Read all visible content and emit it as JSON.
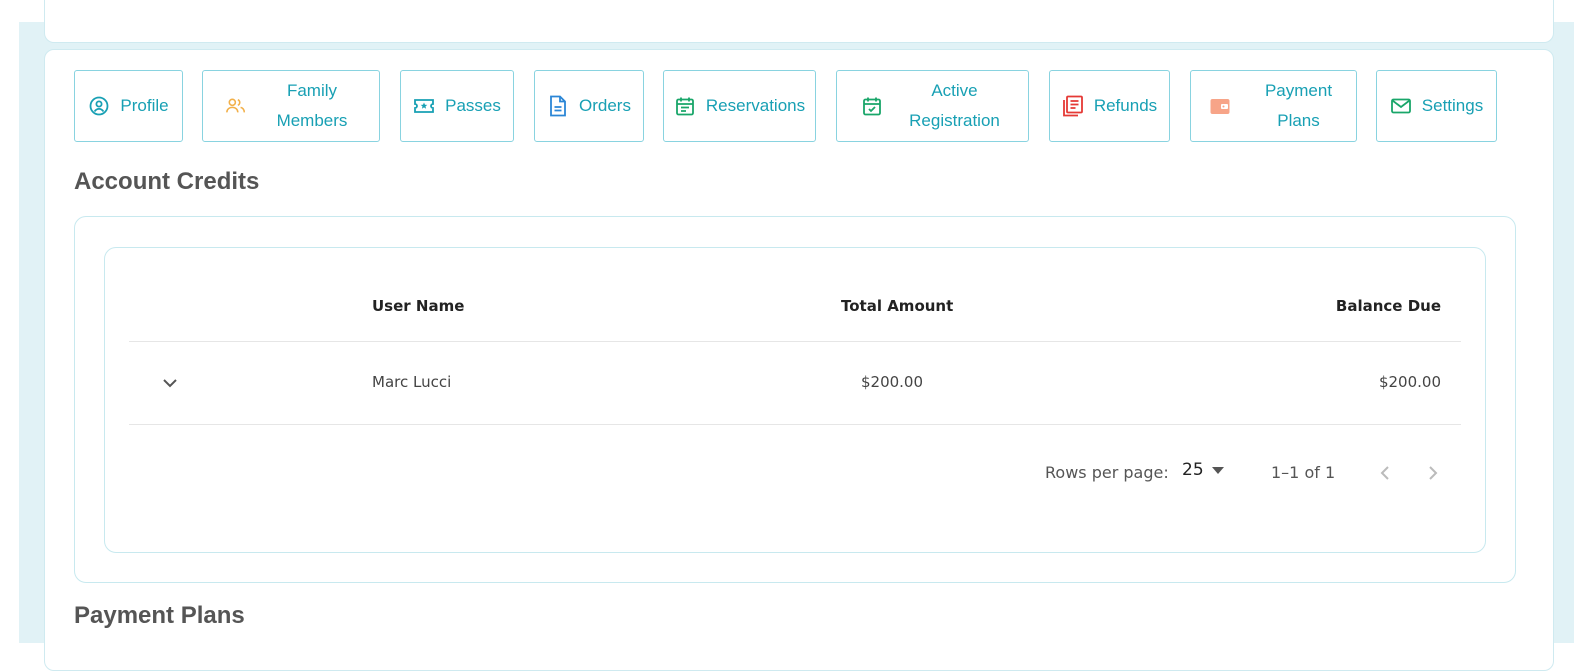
{
  "tabs": [
    {
      "label": "Profile",
      "icon": "profile-circle-icon",
      "color": "#18a0b4"
    },
    {
      "label": "Family Members",
      "icon": "family-members-icon",
      "color": "#f2b04a"
    },
    {
      "label": "Passes",
      "icon": "ticket-icon",
      "color": "#18a0b4"
    },
    {
      "label": "Orders",
      "icon": "document-icon",
      "color": "#2b86d6"
    },
    {
      "label": "Reservations",
      "icon": "calendar-icon",
      "color": "#19a66a"
    },
    {
      "label": "Active Registration",
      "icon": "calendar-check-icon",
      "color": "#19a66a"
    },
    {
      "label": "Refunds",
      "icon": "receipt-icon",
      "color": "#e53935"
    },
    {
      "label": "Payment Plans",
      "icon": "wallet-icon",
      "color": "#f28b6b"
    },
    {
      "label": "Settings",
      "icon": "mail-icon",
      "color": "#19a66a"
    }
  ],
  "sections": {
    "account_credits": "Account Credits",
    "payment_plans": "Payment Plans"
  },
  "table": {
    "headers": [
      "User Name",
      "Total Amount",
      "Balance Due"
    ],
    "rows": [
      {
        "user_name": "Marc Lucci",
        "total_amount": "$200.00",
        "balance_due": "$200.00"
      }
    ]
  },
  "pagination": {
    "rows_per_page_label": "Rows per page:",
    "rows_per_page_value": "25",
    "range": "1–1 of 1"
  },
  "colors": {
    "accent": "#18a0b4",
    "background": "#e1f2f6"
  }
}
